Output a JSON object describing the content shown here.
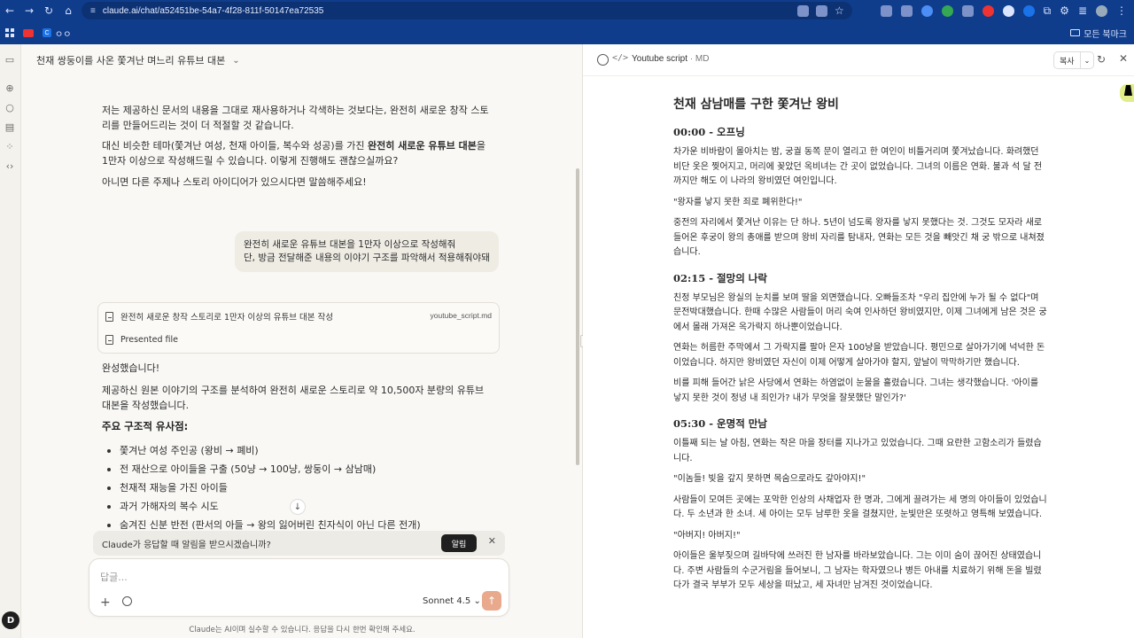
{
  "browser": {
    "url": "claude.ai/chat/a52451be-54a7-4f28-811f-50147ea72535",
    "bookmarks_label": "모든 북마크",
    "bookmark_item": "ㅇㅇ"
  },
  "chat": {
    "title": "천재 쌍둥이를 사온 쫓겨난 며느리 유튜브 대본",
    "assistant_p1": "저는 제공하신 문서의 내용을 그대로 재사용하거나 각색하는 것보다는, 완전히 새로운 창작 스토리를 만들어드리는 것이 더 적절할 것 같습니다.",
    "assistant_p2_pre": "대신 비슷한 테마(쫓겨난 여성, 천재 아이들, 복수와 성공)를 가진 ",
    "assistant_p2_bold": "완전히 새로운 유튜브 대본",
    "assistant_p2_post": "을 1만자 이상으로 작성해드릴 수 있습니다. 이렇게 진행해도 괜찮으실까요?",
    "assistant_p3": "아니면 다른 주제나 스토리 아이디어가 있으시다면 말씀해주세요!",
    "user_line1": "완전히 새로운 유튜브 대본을 1만자 이상으로 작성해줘",
    "user_line2": "단, 방금 전달해준 내용의 이야기 구조를 파악해서 적용해줘야돼",
    "artifact_task": "완전히 새로운 창작 스토리로 1만자 이상의 유튜브 대본 작성",
    "artifact_file": "youtube_script.md",
    "artifact_presented": "Presented file",
    "done": "완성했습니다!",
    "summary": "제공하신 원본 이야기의 구조를 분석하여 완전히 새로운 스토리로 약 10,500자 분량의 유튜브 대본을 작성했습니다.",
    "section_title": "주요 구조적 유사점:",
    "bullets": [
      "쫓겨난 여성 주인공 (왕비 → 폐비)",
      "전 재산으로 아이들을 구출 (50냥 → 100냥, 쌍둥이 → 삼남매)",
      "천재적 재능을 가진 아이들",
      "과거 가해자의 복수 시도",
      "숨겨진 신분 반전 (판서의 아들 → 왕의 잃어버린 친자식이 아닌 다른 전개)"
    ],
    "notify_text": "Claude가 응답할 때 알림을 받으시겠습니까?",
    "notify_button": "알림",
    "composer_placeholder": "답글...",
    "model": "Sonnet 4.5",
    "disclaimer": "Claude는 AI이며 실수할 수 있습니다. 응답을 다시 한번 확인해 주세요."
  },
  "panel": {
    "title": "Youtube script",
    "format": "· MD",
    "copy_label": "복사",
    "doc_title": "천재 삼남매를 구한 쫓겨난 왕비",
    "sections": [
      {
        "heading": "00:00 - 오프닝",
        "paras": [
          "차가운 비바람이 몰아치는 밤, 궁궐 동쪽 문이 열리고 한 여인이 비틀거리며 쫓겨났습니다. 화려했던 비단 옷은 찢어지고, 머리에 꽂았던 옥비녀는 간 곳이 없었습니다. 그녀의 이름은 연화. 불과 석 달 전까지만 해도 이 나라의 왕비였던 여인입니다.",
          "\"왕자를 낳지 못한 죄로 폐위한다!\"",
          "중전의 자리에서 쫓겨난 이유는 단 하나. 5년이 넘도록 왕자를 낳지 못했다는 것. 그것도 모자라 새로 들어온 후궁이 왕의 총애를 받으며 왕비 자리를 탐내자, 연화는 모든 것을 빼앗긴 채 궁 밖으로 내쳐졌습니다."
        ]
      },
      {
        "heading": "02:15 - 절망의 나락",
        "paras": [
          "친정 부모님은 왕실의 눈치를 보며 딸을 외면했습니다. 오빠들조차 \"우리 집안에 누가 될 수 없다\"며 문전박대했습니다. 한때 수많은 사람들이 머리 숙여 인사하던 왕비였지만, 이제 그녀에게 남은 것은 궁에서 몰래 가져온 옥가락지 하나뿐이었습니다.",
          "연화는 허름한 주막에서 그 가락지를 팔아 은자 100냥을 받았습니다. 평민으로 살아가기에 넉넉한 돈이었습니다. 하지만 왕비였던 자신이 이제 어떻게 살아가야 할지, 앞날이 막막하기만 했습니다.",
          "비를 피해 들어간 낡은 사당에서 연화는 하염없이 눈물을 흘렸습니다. 그녀는 생각했습니다. '아이를 낳지 못한 것이 정녕 내 죄인가? 내가 무엇을 잘못했단 말인가?'"
        ]
      },
      {
        "heading": "05:30 - 운명적 만남",
        "paras": [
          "이틀째 되는 날 아침, 연화는 작은 마을 장터를 지나가고 있었습니다. 그때 요란한 고함소리가 들렸습니다.",
          "\"이놈들! 빚을 갚지 못하면 목숨으로라도 갚아야지!\"",
          "사람들이 모여든 곳에는 포악한 인상의 사채업자 한 명과, 그에게 끌려가는 세 명의 아이들이 있었습니다. 두 소년과 한 소녀. 세 아이는 모두 남루한 옷을 걸쳤지만, 눈빛만은 또렷하고 영특해 보였습니다.",
          "\"아버지! 아버지!\"",
          "아이들은 울부짖으며 길바닥에 쓰러진 한 남자를 바라보았습니다. 그는 이미 숨이 끊어진 상태였습니다. 주변 사람들의 수군거림을 들어보니, 그 남자는 학자였으나 병든 아내를 치료하기 위해 돈을 빌렸다가 결국 부부가 모두 세상을 떠났고, 세 자녀만 남겨진 것이었습니다."
        ]
      }
    ]
  }
}
